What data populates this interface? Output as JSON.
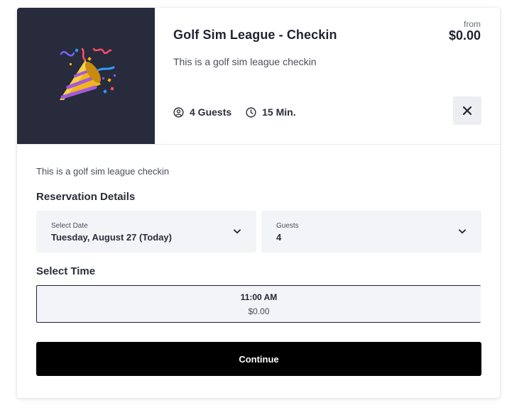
{
  "event": {
    "title": "Golf Sim League - Checkin",
    "subtitle": "This is a golf sim league checkin",
    "price_prefix": "from",
    "price": "$0.00",
    "guests": "4 Guests",
    "duration": "15 Min.",
    "image_icon": "party-popper-icon"
  },
  "description": "This is a golf sim league checkin",
  "reservation": {
    "heading": "Reservation Details",
    "date": {
      "label": "Select Date",
      "value": "Tuesday, August 27 (Today)"
    },
    "guests": {
      "label": "Guests",
      "value": "4"
    }
  },
  "time": {
    "heading": "Select Time",
    "slots": [
      {
        "time": "11:00 AM",
        "price": "$0.00"
      }
    ]
  },
  "continue_label": "Continue",
  "colors": {
    "thumb_bg": "#272b3b",
    "button_bg": "#000000",
    "field_bg": "#f3f4f7"
  }
}
